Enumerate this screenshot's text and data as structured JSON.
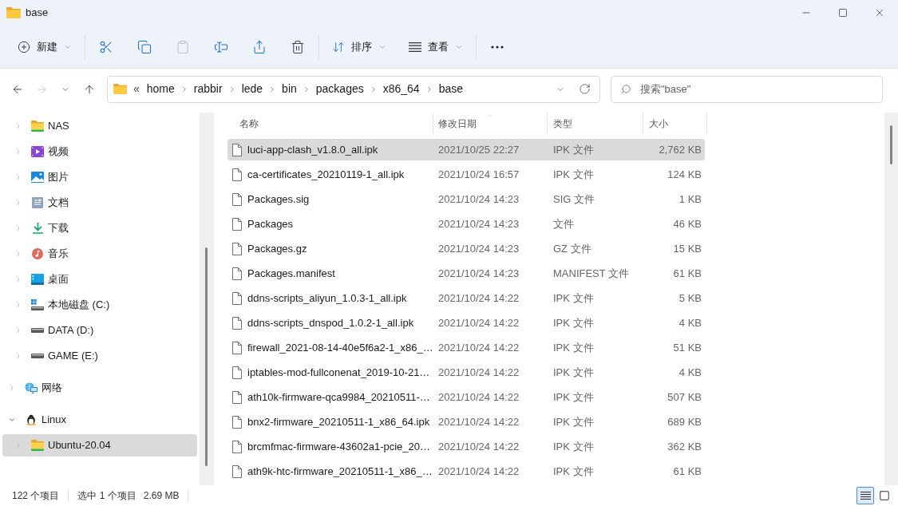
{
  "window": {
    "title": "base"
  },
  "toolbar": {
    "groups": [
      [
        {
          "kind": "new",
          "label": "新建",
          "menu": true,
          "disabled": false
        }
      ],
      [
        {
          "kind": "cut",
          "disabled": false
        },
        {
          "kind": "copy",
          "disabled": false
        },
        {
          "kind": "paste",
          "disabled": true
        },
        {
          "kind": "rename",
          "disabled": false
        },
        {
          "kind": "share",
          "disabled": false
        },
        {
          "kind": "delete",
          "disabled": false
        }
      ],
      [
        {
          "kind": "sort",
          "label": "排序",
          "menu": true,
          "disabled": false
        },
        {
          "kind": "view",
          "label": "查看",
          "menu": true,
          "disabled": false
        }
      ],
      [
        {
          "kind": "more",
          "disabled": false
        }
      ]
    ]
  },
  "navigation": [
    {
      "kind": "back",
      "disabled": false
    },
    {
      "kind": "forward",
      "disabled": true
    },
    {
      "kind": "recent",
      "disabled": false
    },
    {
      "kind": "up",
      "disabled": false
    }
  ],
  "address_bar": {
    "overflow": "«",
    "segments": [
      "home",
      "rabbir",
      "lede",
      "bin",
      "packages",
      "x86_64",
      "base"
    ]
  },
  "search": {
    "placeholder": "搜索\"base\""
  },
  "sidebar": {
    "tree": [
      {
        "children": [
          {
            "label": "NAS",
            "kind": "folder",
            "expanded": false,
            "selected": false
          },
          {
            "label": "视频",
            "kind": "video",
            "expanded": false,
            "selected": false
          },
          {
            "label": "图片",
            "kind": "pictures",
            "expanded": false,
            "selected": false
          },
          {
            "label": "文档",
            "kind": "documents",
            "expanded": false,
            "selected": false
          },
          {
            "label": "下载",
            "kind": "downloads",
            "expanded": false,
            "selected": false
          },
          {
            "label": "音乐",
            "kind": "music",
            "expanded": false,
            "selected": false
          },
          {
            "label": "桌面",
            "kind": "desktop",
            "expanded": false,
            "selected": false
          },
          {
            "label": "本地磁盘 (C:)",
            "kind": "system-drive",
            "expanded": false,
            "selected": false
          },
          {
            "label": "DATA (D:)",
            "kind": "drive",
            "expanded": false,
            "selected": false
          },
          {
            "label": "GAME (E:)",
            "kind": "drive",
            "expanded": false,
            "selected": false
          }
        ]
      },
      {
        "label": "网络",
        "kind": "network",
        "expanded": false,
        "selected": false
      },
      {
        "label": "Linux",
        "kind": "linux",
        "expanded": true,
        "selected": false,
        "children": [
          {
            "label": "Ubuntu-20.04",
            "kind": "folder",
            "expanded": false,
            "selected": true
          }
        ]
      }
    ]
  },
  "file_list": {
    "columns": [
      {
        "label": "名称",
        "sorted": false
      },
      {
        "label": "修改日期",
        "sorted": true
      },
      {
        "label": "类型",
        "sorted": false
      },
      {
        "label": "大小",
        "sorted": false
      }
    ],
    "rows": [
      {
        "name": "luci-app-clash_v1.8.0_all.ipk",
        "modified": "2021/10/25 22:27",
        "type": "IPK 文件",
        "size": "2,762 KB",
        "selected": true
      },
      {
        "name": "ca-certificates_20210119-1_all.ipk",
        "modified": "2021/10/24 16:57",
        "type": "IPK 文件",
        "size": "124 KB",
        "selected": false
      },
      {
        "name": "Packages.sig",
        "modified": "2021/10/24 14:23",
        "type": "SIG 文件",
        "size": "1 KB",
        "selected": false
      },
      {
        "name": "Packages",
        "modified": "2021/10/24 14:23",
        "type": "文件",
        "size": "46 KB",
        "selected": false
      },
      {
        "name": "Packages.gz",
        "modified": "2021/10/24 14:23",
        "type": "GZ 文件",
        "size": "15 KB",
        "selected": false
      },
      {
        "name": "Packages.manifest",
        "modified": "2021/10/24 14:23",
        "type": "MANIFEST 文件",
        "size": "61 KB",
        "selected": false
      },
      {
        "name": "ddns-scripts_aliyun_1.0.3-1_all.ipk",
        "modified": "2021/10/24 14:22",
        "type": "IPK 文件",
        "size": "5 KB",
        "selected": false
      },
      {
        "name": "ddns-scripts_dnspod_1.0.2-1_all.ipk",
        "modified": "2021/10/24 14:22",
        "type": "IPK 文件",
        "size": "4 KB",
        "selected": false
      },
      {
        "name": "firewall_2021-08-14-40e5f6a2-1_x86_…",
        "modified": "2021/10/24 14:22",
        "type": "IPK 文件",
        "size": "51 KB",
        "selected": false
      },
      {
        "name": "iptables-mod-fullconenat_2019-10-21…",
        "modified": "2021/10/24 14:22",
        "type": "IPK 文件",
        "size": "4 KB",
        "selected": false
      },
      {
        "name": "ath10k-firmware-qca9984_20210511-…",
        "modified": "2021/10/24 14:22",
        "type": "IPK 文件",
        "size": "507 KB",
        "selected": false
      },
      {
        "name": "bnx2-firmware_20210511-1_x86_64.ipk",
        "modified": "2021/10/24 14:22",
        "type": "IPK 文件",
        "size": "689 KB",
        "selected": false
      },
      {
        "name": "brcmfmac-firmware-43602a1-pcie_20…",
        "modified": "2021/10/24 14:22",
        "type": "IPK 文件",
        "size": "362 KB",
        "selected": false
      },
      {
        "name": "ath9k-htc-firmware_20210511-1_x86_…",
        "modified": "2021/10/24 14:22",
        "type": "IPK 文件",
        "size": "61 KB",
        "selected": false
      }
    ]
  },
  "status_bar": {
    "item_count": "122 个项目",
    "selection": "选中 1 个项目",
    "selection_size": "2.69 MB",
    "views": [
      {
        "kind": "details",
        "selected": true
      },
      {
        "kind": "tiles",
        "selected": false
      }
    ]
  }
}
